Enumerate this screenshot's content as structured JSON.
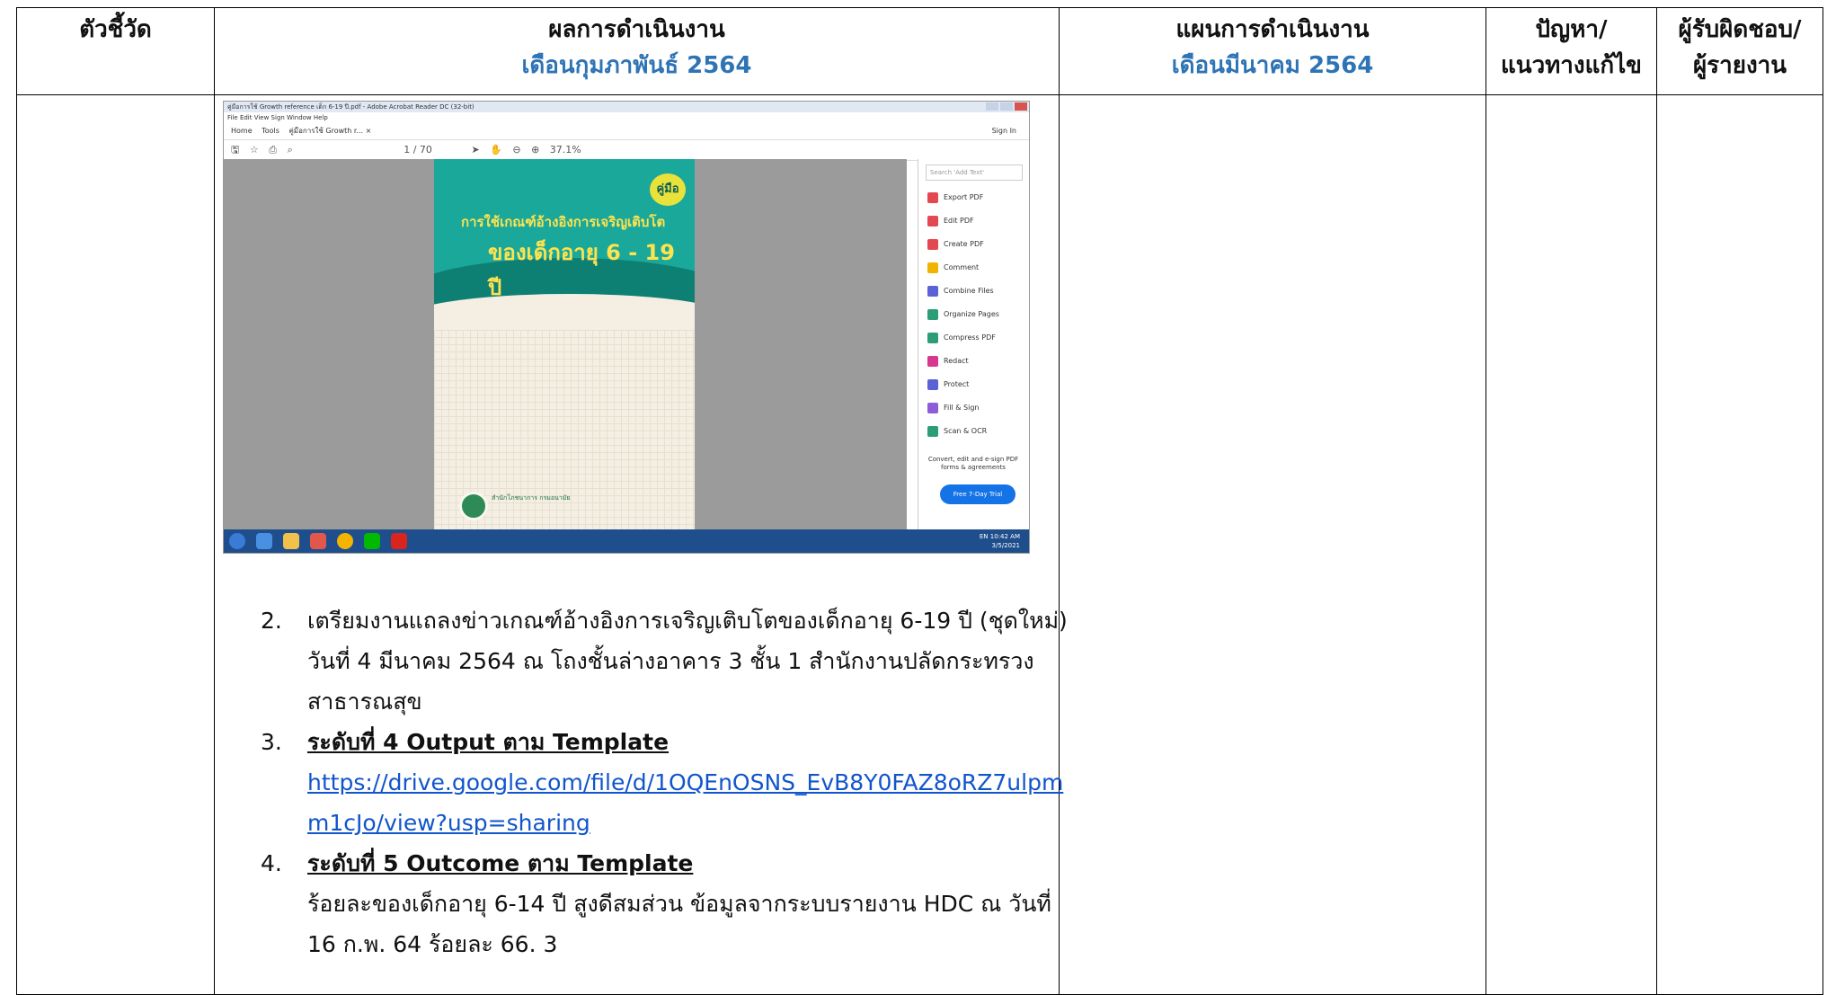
{
  "headers": {
    "indicator": "ตัวชี้วัด",
    "results_title": "ผลการดำเนินงาน",
    "results_month": "เดือนกุมภาพันธ์ 2564",
    "plan_title": "แผนการดำเนินงาน",
    "plan_month": "เดือนมีนาคม 2564",
    "problem_line1": "ปัญหา/",
    "problem_line2": "แนวทางแก้ไข",
    "owner_line1": "ผู้รับผิดชอบ/",
    "owner_line2": "ผู้รายงาน"
  },
  "screenshot": {
    "window_title": "คู่มือการใช้ Growth reference เด็ก 6-19 ปี.pdf - Adobe Acrobat Reader DC (32-bit)",
    "menu": "File  Edit  View  Sign  Window  Help",
    "tab_home": "Home",
    "tab_tools": "Tools",
    "tab_doc": "คู่มือการใช้ Growth r... ×",
    "sign_in": "Sign In",
    "toolbar_page": "1 / 70",
    "toolbar_zoom": "37.1%",
    "cover_badge": "คู่มือ",
    "cover_title1": "การใช้เกณฑ์อ้างอิงการเจริญเติบโต",
    "cover_title2": "ของเด็กอายุ 6 - 19 ปี",
    "cover_publisher": "สำนักโภชนาการ กรมอนามัย",
    "search_placeholder": "Search 'Add Text'",
    "panel_items": [
      {
        "label": "Export PDF",
        "color": "#e34850"
      },
      {
        "label": "Edit PDF",
        "color": "#e34850"
      },
      {
        "label": "Create PDF",
        "color": "#e34850"
      },
      {
        "label": "Comment",
        "color": "#f0b400"
      },
      {
        "label": "Combine Files",
        "color": "#5c62d6"
      },
      {
        "label": "Organize Pages",
        "color": "#2d9d78"
      },
      {
        "label": "Compress PDF",
        "color": "#2d9d78"
      },
      {
        "label": "Redact",
        "color": "#d83790"
      },
      {
        "label": "Protect",
        "color": "#5c62d6"
      },
      {
        "label": "Fill & Sign",
        "color": "#8e5cd9"
      },
      {
        "label": "Scan & OCR",
        "color": "#2d9d78"
      }
    ],
    "promo": "Convert, edit and e-sign PDF forms & agreements",
    "trial_button": "Free 7-Day Trial",
    "clock_time": "10:42 AM",
    "clock_date": "3/5/2021",
    "lang": "EN"
  },
  "list": [
    {
      "num": "2.",
      "text": "เตรียมงานแถลงข่าวเกณฑ์อ้างอิงการเจริญเติบโตของเด็กอายุ 6-19 ปี (ชุดใหม่) วันที่ 4 มีนาคม  2564 ณ  โถงชั้นล่างอาคาร 3 ชั้น 1 สำนักงานปลัดกระทรวงสาธารณสุข"
    },
    {
      "num": "3.",
      "heading": "ระดับที่ 4 Output ตาม Template ",
      "link": "https://drive.google.com/file/d/1OQEnOSNS_EvB8Y0FAZ8oRZ7ulpmm1cJo/view?usp=sharing "
    },
    {
      "num": "4.",
      "heading": "ระดับที่ 5 Outcome ตาม Template",
      "text": "ร้อยละของเด็กอายุ 6-14 ปี สูงดีสมส่วน ข้อมูลจากระบบรายงาน HDC ณ วันที่ 16 ก.พ. 64  ร้อยละ 66. 3"
    }
  ]
}
